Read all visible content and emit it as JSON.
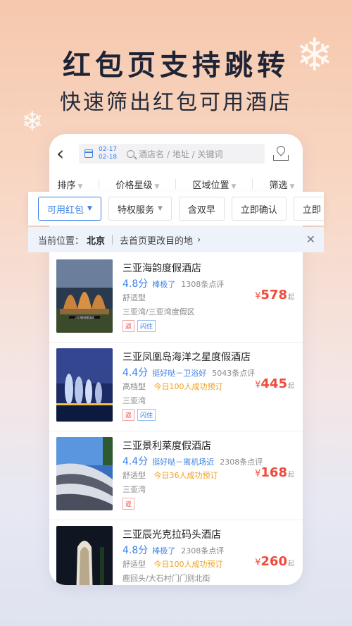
{
  "banner": {
    "headline": "红包页支持跳转",
    "subhead": "快速筛出红包可用酒店"
  },
  "topbar": {
    "date_in": "02-17",
    "date_out": "02-18",
    "search_placeholder": "酒店名 / 地址 / 关键词"
  },
  "filters": [
    {
      "label": "排序"
    },
    {
      "label": "价格星级"
    },
    {
      "label": "区域位置"
    },
    {
      "label": "筛选"
    }
  ],
  "chips": [
    {
      "label": "可用红包",
      "active": true
    },
    {
      "label": "特权服务"
    },
    {
      "label": "含双早"
    },
    {
      "label": "立即确认"
    },
    {
      "label": "立即"
    }
  ],
  "location": {
    "prefix": "当前位置：",
    "city": "北京",
    "change_link": "去首页更改目的地"
  },
  "hotels": [
    {
      "name": "三亚海韵度假酒店",
      "score": "4.8分",
      "praise": "棒极了",
      "reviews": "1308条点评",
      "type": "舒适型",
      "booking": "",
      "address": "三亚湾/三亚湾度假区",
      "tags": [
        "返",
        "闪住"
      ],
      "price": "578",
      "price_symbol": "¥",
      "price_suffix": "起",
      "thumb_label": "三亚海韵度假酒店"
    },
    {
      "name": "三亚凤凰岛海洋之星度假酒店",
      "score": "4.4分",
      "praise": "挺好哒－卫浴好",
      "reviews": "5043条点评",
      "type": "高档型",
      "booking": "今日100人成功预订",
      "address": "三亚湾",
      "tags": [
        "返",
        "闪住"
      ],
      "price": "445",
      "price_symbol": "¥",
      "price_suffix": "起"
    },
    {
      "name": "三亚景利莱度假酒店",
      "score": "4.4分",
      "praise": "挺好哒－离机场近",
      "reviews": "2308条点评",
      "type": "舒适型",
      "booking": "今日36人成功预订",
      "address": "三亚湾",
      "tags": [
        "返"
      ],
      "price": "168",
      "price_symbol": "¥",
      "price_suffix": "起"
    },
    {
      "name": "三亚辰光克拉码头酒店",
      "score": "4.8分",
      "praise": "棒极了",
      "reviews": "2308条点评",
      "type": "舒适型",
      "booking": "今日100人成功预订",
      "address": "鹿回头/大石村门门则北街",
      "tags": [],
      "price": "260",
      "price_symbol": "¥",
      "price_suffix": "起"
    }
  ]
}
